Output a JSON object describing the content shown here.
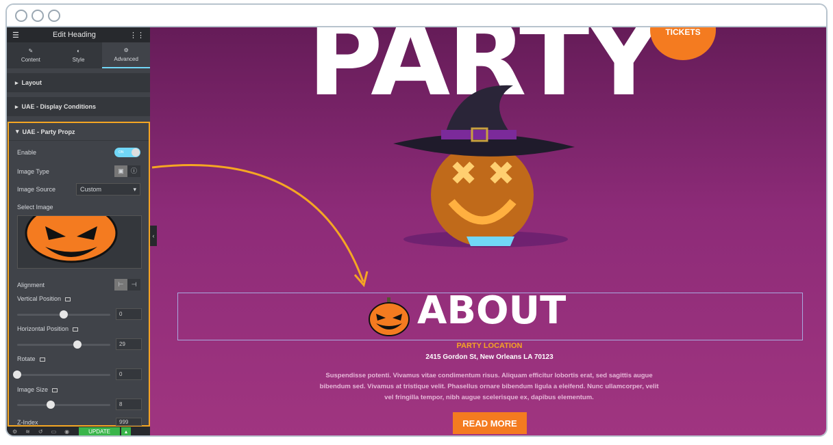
{
  "editor": {
    "title": "Edit Heading",
    "tabs": [
      {
        "label": "Content",
        "icon": "pencil-icon"
      },
      {
        "label": "Style",
        "icon": "contrast-icon"
      },
      {
        "label": "Advanced",
        "icon": "gear-icon",
        "active": true
      }
    ],
    "sections": [
      "Layout",
      "UAE - Display Conditions"
    ],
    "panel": {
      "title": "UAE - Party Propz",
      "enable_label": "Enable",
      "enable_state": "ON",
      "image_type_label": "Image Type",
      "image_source_label": "Image Source",
      "image_source_value": "Custom",
      "select_image_label": "Select Image",
      "alignment_label": "Alignment",
      "vertical_label": "Vertical Position",
      "vertical_value": "0",
      "vertical_slider": 0.5,
      "horizontal_label": "Horizontal Position",
      "horizontal_value": "29",
      "horizontal_slider": 0.65,
      "rotate_label": "Rotate",
      "rotate_value": "0",
      "rotate_slider": 0,
      "size_label": "Image Size",
      "size_value": "8",
      "size_slider": 0.36,
      "zindex_label": "Z-Index",
      "zindex_value": "999"
    },
    "update_label": "UPDATE"
  },
  "page": {
    "hero_title": "PARTY",
    "tickets_label": "TICKETS",
    "about_heading": "ABOUT",
    "location_label": "PARTY LOCATION",
    "address": "2415 Gordon St, New Orleans LA 70123",
    "body": "Suspendisse potenti. Vivamus vitae condimentum risus. Aliquam efficitur lobortis erat, sed sagittis augue bibendum sed. Vivamus at tristique velit. Phasellus ornare bibendum ligula a eleifend. Nunc ullamcorper, velit vel fringilla tempor, nibh augue scelerisque ex, dapibus elementum.",
    "read_more": "READ MORE"
  },
  "colors": {
    "accent": "#f47b20",
    "highlight": "#f5a623",
    "canvas": "#8d2b78",
    "toggle": "#71d7f7",
    "update": "#39b54a"
  }
}
